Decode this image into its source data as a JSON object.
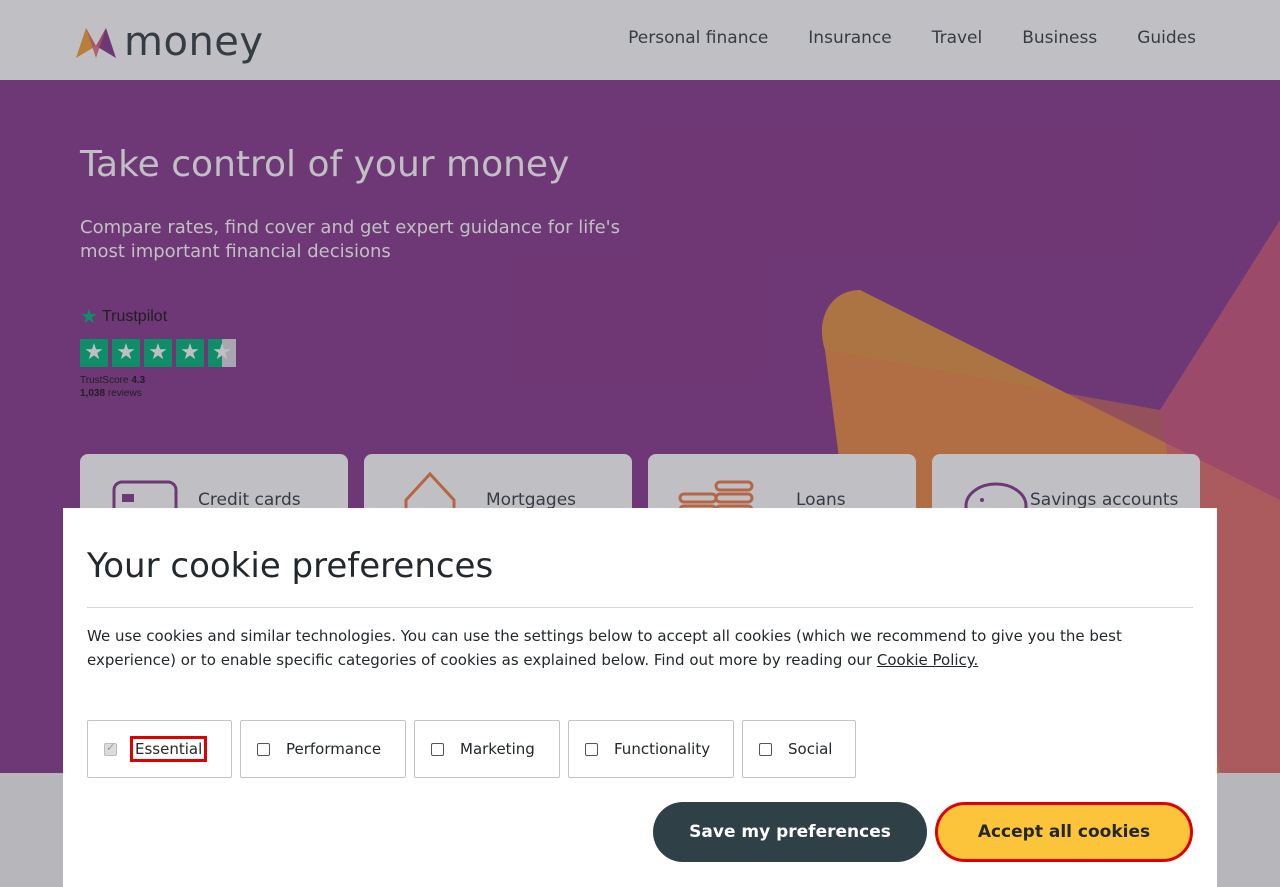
{
  "header": {
    "logo_text": "money",
    "nav": [
      "Personal finance",
      "Insurance",
      "Travel",
      "Business",
      "Guides"
    ]
  },
  "hero": {
    "title": "Take control of your money",
    "subtitle": "Compare rates, find cover and get expert guidance for life's most important financial decisions",
    "trustpilot": {
      "brand": "Trustpilot",
      "score_label": "TrustScore",
      "score": "4.3",
      "reviews_count": "1,038",
      "reviews_label": "reviews",
      "stars": 4.5
    },
    "categories": [
      {
        "label": "Credit cards",
        "icon": "credit-card-icon"
      },
      {
        "label": "Mortgages",
        "icon": "house-icon"
      },
      {
        "label": "Loans",
        "icon": "coins-icon"
      },
      {
        "label": "Savings accounts",
        "icon": "piggy-bank-icon"
      }
    ]
  },
  "cookie_modal": {
    "title": "Your cookie preferences",
    "body": "We use cookies and similar technologies. You can use the settings below to accept all cookies (which we recommend to give you the best experience) or to enable specific categories of cookies as explained below. Find out more by reading our",
    "policy_link": "Cookie Policy.",
    "preferences": [
      {
        "label": "Essential",
        "checked": true,
        "disabled": true
      },
      {
        "label": "Performance",
        "checked": false
      },
      {
        "label": "Marketing",
        "checked": false
      },
      {
        "label": "Functionality",
        "checked": false
      },
      {
        "label": "Social",
        "checked": false
      }
    ],
    "save_label": "Save my preferences",
    "accept_label": "Accept all cookies"
  },
  "colors": {
    "hero_bg": "#8a3b8e",
    "accent_yellow": "#fbc43b",
    "dark_button": "#2f4047",
    "trustpilot_green": "#00b67a",
    "highlight_red": "#e00000"
  }
}
